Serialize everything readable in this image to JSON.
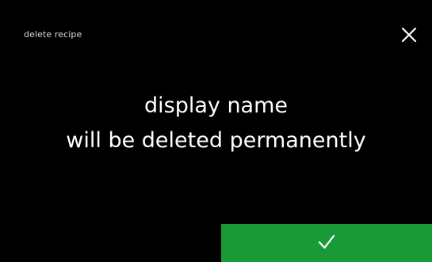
{
  "header": {
    "title": "delete recipe"
  },
  "message": {
    "line1": "display name",
    "line2": "will be deleted permanently"
  },
  "buttons": {
    "close_icon": "close-icon",
    "confirm_icon": "checkmark-icon"
  },
  "colors": {
    "background": "#000000",
    "confirm": "#1a9a37",
    "text": "#ffffff"
  }
}
